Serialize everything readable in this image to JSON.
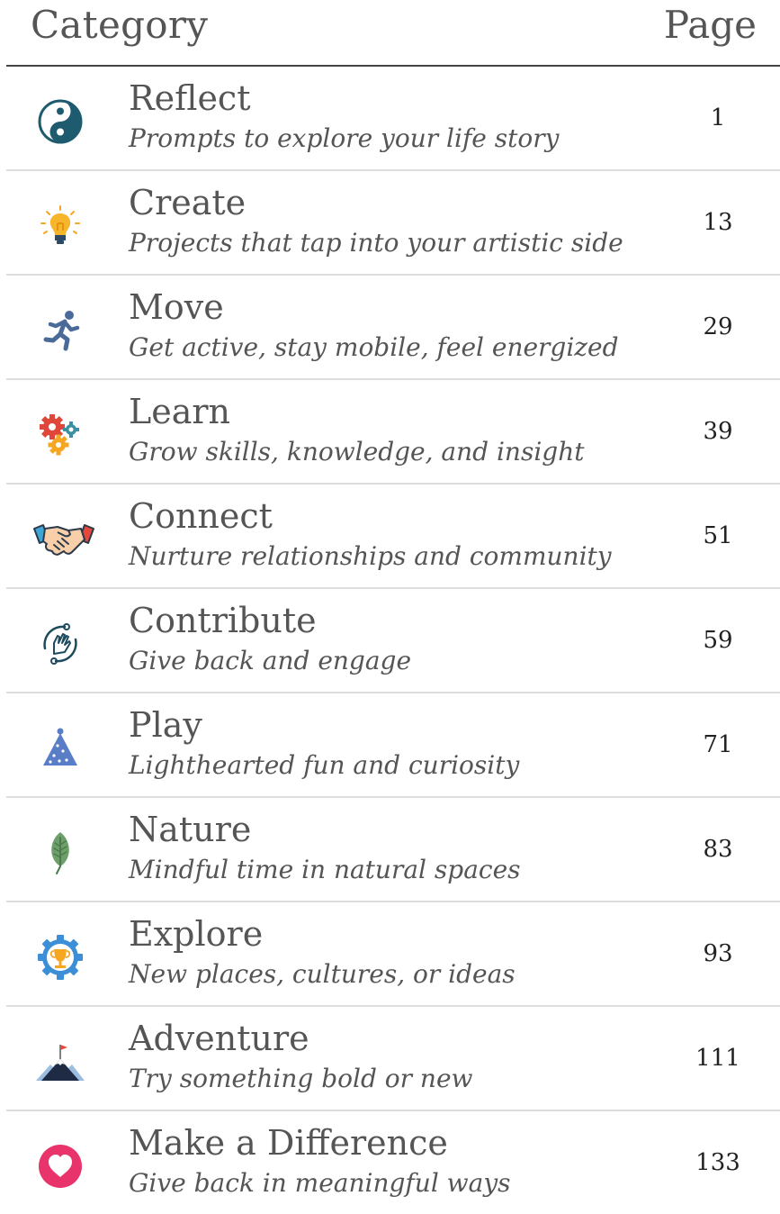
{
  "header": {
    "category_label": "Category",
    "page_label": "Page"
  },
  "rows": [
    {
      "icon": "yin-yang-icon",
      "title": "Reflect",
      "subtitle": "Prompts to explore your life story",
      "page": "1"
    },
    {
      "icon": "lightbulb-icon",
      "title": "Create",
      "subtitle": "Projects that tap into your artistic side",
      "page": "13"
    },
    {
      "icon": "runner-icon",
      "title": "Move",
      "subtitle": "Get active, stay mobile, feel energized",
      "page": "29"
    },
    {
      "icon": "gears-icon",
      "title": "Learn",
      "subtitle": "Grow skills, knowledge, and insight",
      "page": "39"
    },
    {
      "icon": "handshake-icon",
      "title": "Connect",
      "subtitle": "Nurture relationships and community",
      "page": "51"
    },
    {
      "icon": "helping-hand-icon",
      "title": "Contribute",
      "subtitle": "Give back and engage",
      "page": "59"
    },
    {
      "icon": "party-hat-icon",
      "title": "Play",
      "subtitle": "Lighthearted fun and curiosity",
      "page": "71"
    },
    {
      "icon": "leaf-icon",
      "title": "Nature",
      "subtitle": "Mindful time in natural spaces",
      "page": "83"
    },
    {
      "icon": "trophy-gear-icon",
      "title": "Explore",
      "subtitle": "New places, cultures, or ideas",
      "page": "93"
    },
    {
      "icon": "mountain-flag-icon",
      "title": "Adventure",
      "subtitle": "Try something bold or new",
      "page": "111"
    },
    {
      "icon": "heart-icon",
      "title": "Make a Difference",
      "subtitle": "Give back in meaningful ways",
      "page": "133"
    }
  ]
}
